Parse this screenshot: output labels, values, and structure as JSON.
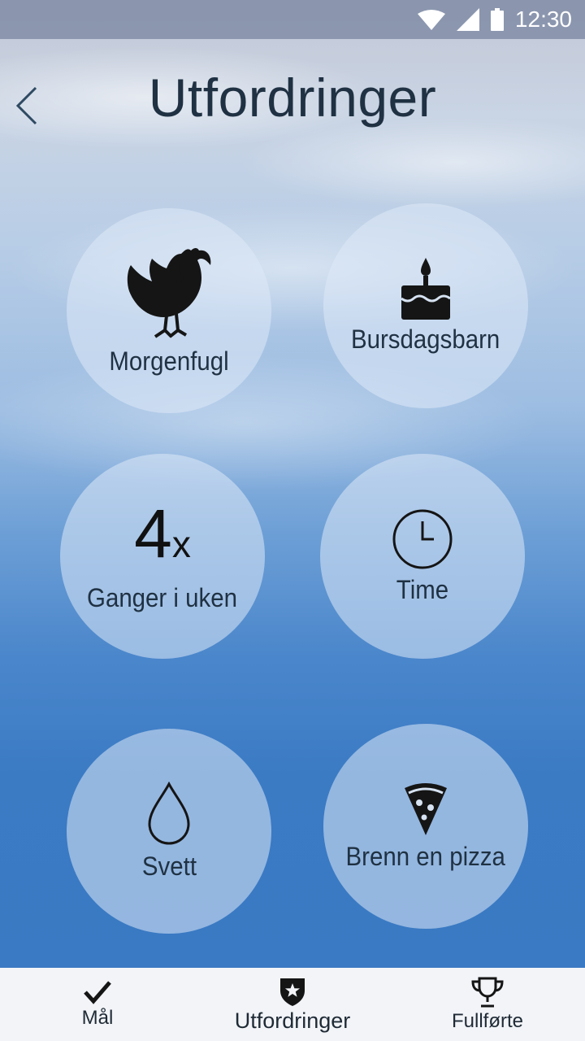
{
  "status_bar": {
    "time": "12:30",
    "icons": [
      "wifi-icon",
      "cell-signal-icon",
      "battery-icon"
    ]
  },
  "header": {
    "title": "Utfordringer",
    "back_icon": "chevron-left-icon"
  },
  "challenges": [
    {
      "label": "Morgenfugl",
      "icon": "rooster-icon"
    },
    {
      "label": "Bursdagsbarn",
      "icon": "birthday-cake-icon"
    },
    {
      "number": "4",
      "suffix": "x",
      "label": "Ganger i uken"
    },
    {
      "label": "Time",
      "icon": "clock-icon"
    },
    {
      "label": "Svett",
      "icon": "drop-icon"
    },
    {
      "label": "Brenn en pizza",
      "icon": "pizza-slice-icon"
    }
  ],
  "bottom_nav": [
    {
      "label": "Mål",
      "icon": "checkmark-icon"
    },
    {
      "label": "Utfordringer",
      "icon": "shield-star-icon",
      "active": true
    },
    {
      "label": "Fullførte",
      "icon": "trophy-icon"
    }
  ]
}
